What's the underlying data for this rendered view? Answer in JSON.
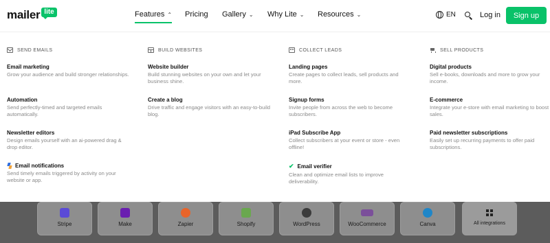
{
  "header": {
    "logo_word": "mailer",
    "logo_badge": "lite",
    "nav": [
      {
        "label": "Features",
        "arrow": "⌃",
        "active": true
      },
      {
        "label": "Pricing",
        "arrow": ""
      },
      {
        "label": "Gallery",
        "arrow": "⌄"
      },
      {
        "label": "Why Lite",
        "arrow": "⌄"
      },
      {
        "label": "Resources",
        "arrow": "⌄"
      }
    ],
    "lang": "EN",
    "login": "Log in",
    "signup": "Sign up",
    "accent": "#09c269"
  },
  "menu": {
    "columns": [
      {
        "heading": "SEND EMAILS",
        "icon": "mail-icon",
        "entries": [
          {
            "title": "Email marketing",
            "desc": "Grow your audience and build stronger relationships."
          },
          {
            "title": "Automation",
            "desc": "Send perfectly-timed and targeted emails automatically."
          },
          {
            "title": "Newsletter editors",
            "desc": "Design emails yourself with an ai-powered drag & drop editor."
          },
          {
            "title": "Email notifications",
            "desc": "Send timely emails triggered by activity on your website or app.",
            "icon": "bolt-icon"
          }
        ]
      },
      {
        "heading": "BUILD WEBSITES",
        "icon": "website-icon",
        "entries": [
          {
            "title": "Website builder",
            "desc": "Build stunning websites on your own and let your business shine."
          },
          {
            "title": "Create a blog",
            "desc": "Drive traffic and engage visitors with an easy-to-build blog."
          }
        ]
      },
      {
        "heading": "COLLECT LEADS",
        "icon": "leads-icon",
        "entries": [
          {
            "title": "Landing pages",
            "desc": "Create pages to collect leads, sell products and more."
          },
          {
            "title": "Signup forms",
            "desc": "Invite people from across the web to become subscribers."
          },
          {
            "title": "iPad Subscribe App",
            "desc": "Collect subscribers at your event or store - even offline!"
          },
          {
            "title": "Email verifier",
            "desc": "Clean and optimize email lists to improve deliverability.",
            "icon": "check-icon"
          }
        ]
      },
      {
        "heading": "SELL PRODUCTS",
        "icon": "cart-icon",
        "entries": [
          {
            "title": "Digital products",
            "desc": "Sell e-books, downloads and more to grow your income."
          },
          {
            "title": "E-commerce",
            "desc": "Integrate your e-store with email marketing to boost sales."
          },
          {
            "title": "Paid newsletter subscriptions",
            "desc": "Easily set up recurring payments to offer paid subscriptions."
          }
        ]
      }
    ]
  },
  "integrations": [
    {
      "label": "Stripe",
      "icon": "stripe-icon",
      "color": "#5b4bd6"
    },
    {
      "label": "Make",
      "icon": "make-icon",
      "color": "#6a1fb0"
    },
    {
      "label": "Zapier",
      "icon": "zapier-icon",
      "color": "#e8642a"
    },
    {
      "label": "Shopify",
      "icon": "shopify-icon",
      "color": "#6aa84f"
    },
    {
      "label": "WordPress",
      "icon": "wordpress-icon",
      "color": "#3b3b3b"
    },
    {
      "label": "WooCommerce",
      "icon": "woocommerce-icon",
      "color": "#7b4f9a"
    },
    {
      "label": "Canva",
      "icon": "canva-icon",
      "color": "#1f86c8"
    },
    {
      "label": "All integrations",
      "icon": "grid-icon",
      "color": "#222222"
    }
  ]
}
